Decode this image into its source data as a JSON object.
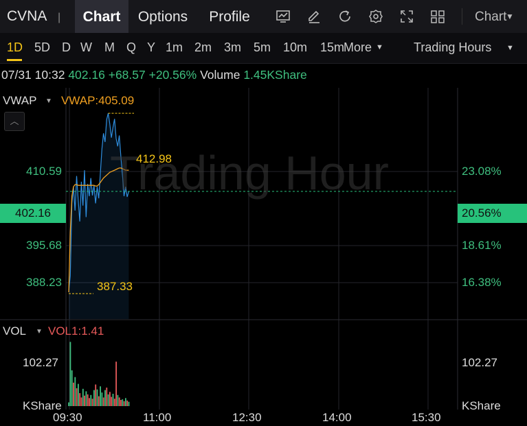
{
  "topbar": {
    "ticker": "CVNA",
    "separator": "|",
    "tabs": [
      "Chart",
      "Options",
      "Profile"
    ],
    "active_tab": "Chart",
    "icons": [
      "indicator-icon",
      "draw-icon",
      "refresh-icon",
      "settings-icon",
      "fullscreen-icon",
      "layout-icon"
    ],
    "chart_type_label": "Chart"
  },
  "periods": {
    "items": [
      "1D",
      "5D",
      "D",
      "W",
      "M",
      "Q",
      "Y",
      "1m",
      "2m",
      "3m",
      "5m",
      "10m",
      "15m"
    ],
    "active": "1D",
    "more_label": "More",
    "session_label": "Trading Hours"
  },
  "quote": {
    "time": "07/31 10:32",
    "price": "402.16",
    "change": "+68.57",
    "change_pct": "+20.56%",
    "volume_label": "Volume",
    "volume_value": "1.45KShare"
  },
  "price_panel": {
    "indicator_label": "VWAP",
    "indicator_value": "VWAP:405.09",
    "watermark": "Trading Hour",
    "left_axis": [
      "410.59",
      "395.68",
      "388.23"
    ],
    "right_axis": [
      "23.08%",
      "18.61%",
      "16.38%"
    ],
    "current_price": "402.16",
    "current_pct": "20.56%",
    "high_annotation": "412.98",
    "low_annotation": "387.33"
  },
  "volume_panel": {
    "indicator_label": "VOL",
    "indicator_value": "VOL1:1.41",
    "axis_top": "102.27",
    "axis_unit": "KShare"
  },
  "time_axis": [
    "09:30",
    "11:00",
    "12:30",
    "14:00",
    "15:30"
  ],
  "colors": {
    "up": "#3fbf7f",
    "down": "#e85a5a",
    "accent": "#f5c518",
    "vwap": "#f0a020",
    "price_line": "#2f8fe0"
  },
  "chart_data": {
    "type": "line",
    "x_start": "09:30",
    "price": [
      388.2,
      390.5,
      400.5,
      402.8,
      399.5,
      404.3,
      401.0,
      398.0,
      403.5,
      400.2,
      405.1,
      398.6,
      403.2,
      401.5,
      404.0,
      401.6,
      403.0,
      400.5,
      402.8,
      401.2,
      404.6,
      408.0,
      410.2,
      409.0,
      412.1,
      412.98,
      411.5,
      409.6,
      411.0,
      412.2,
      409.5,
      408.4,
      409.9,
      407.0,
      404.5,
      401.5,
      402.8,
      401.4,
      402.16
    ],
    "vwap": [
      388.2,
      396.5,
      401.5,
      402.8,
      403.1,
      403.1,
      403.0,
      403.0,
      403.0,
      403.0,
      403.0,
      403.0,
      403.0,
      403.0,
      403.0,
      403.0,
      403.0,
      402.9,
      402.9,
      403.1,
      403.4,
      403.7,
      404.0,
      404.2,
      404.4,
      404.6,
      404.8,
      404.9,
      405.0,
      405.1,
      405.2,
      405.3,
      405.4,
      405.4,
      405.3,
      405.2,
      405.1,
      405.1,
      405.09
    ],
    "volume": [
      6,
      104,
      58,
      38,
      47,
      29,
      36,
      21,
      14,
      28,
      17,
      24,
      19,
      13,
      18,
      12,
      26,
      35,
      27,
      16,
      32,
      22,
      14,
      26,
      30,
      19,
      23,
      15,
      20,
      12,
      72,
      18,
      14,
      10,
      11,
      8,
      13,
      9,
      7
    ],
    "volume_up": [
      1,
      1,
      1,
      0,
      1,
      0,
      1,
      0,
      0,
      1,
      0,
      1,
      0,
      0,
      1,
      0,
      1,
      0,
      1,
      0,
      1,
      1,
      0,
      1,
      0,
      1,
      0,
      0,
      1,
      0,
      0,
      1,
      0,
      0,
      1,
      0,
      1,
      0,
      1
    ],
    "y_range": [
      384.5,
      416.5
    ],
    "volume_max": 102.27,
    "ylabel": "",
    "xlabel": ""
  }
}
